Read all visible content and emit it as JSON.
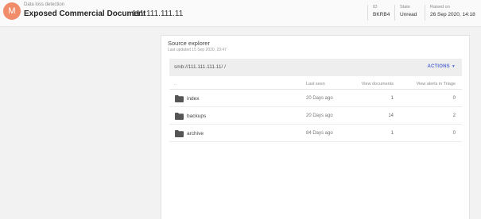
{
  "header": {
    "avatar_letter": "M",
    "eyebrow": "Data loss detection",
    "title": "Exposed Commercial Document",
    "ip": "111.111.111.11",
    "meta": [
      {
        "key": "ID",
        "value": "BKRB4"
      },
      {
        "key": "State",
        "value": "Unread"
      },
      {
        "key": "Raised on",
        "value": "26 Sep 2020, 14:18"
      }
    ]
  },
  "card": {
    "title": "Source explorer",
    "subtitle": "Last updated 15 Sep 2020, 23:47",
    "path": "smb://111.111.111.11/ /",
    "actions_label": "ACTIONS",
    "columns": {
      "name": "..",
      "last_seen": "Last seen",
      "view_documents": "View documents",
      "view_alerts": "View alerts in Triage"
    },
    "rows": [
      {
        "name": "index",
        "last_seen": "20 Days ago",
        "documents": "1",
        "alerts": "0"
      },
      {
        "name": "backups",
        "last_seen": "20 Days ago",
        "documents": "14",
        "alerts": "2"
      },
      {
        "name": "archive",
        "last_seen": "84 Days ago",
        "documents": "1",
        "alerts": "0"
      }
    ]
  },
  "icons": {
    "folder": "folder-icon",
    "caret": "caret-down-icon"
  },
  "colors": {
    "avatar": "#f08c6a",
    "accent": "#5a6fd6"
  }
}
